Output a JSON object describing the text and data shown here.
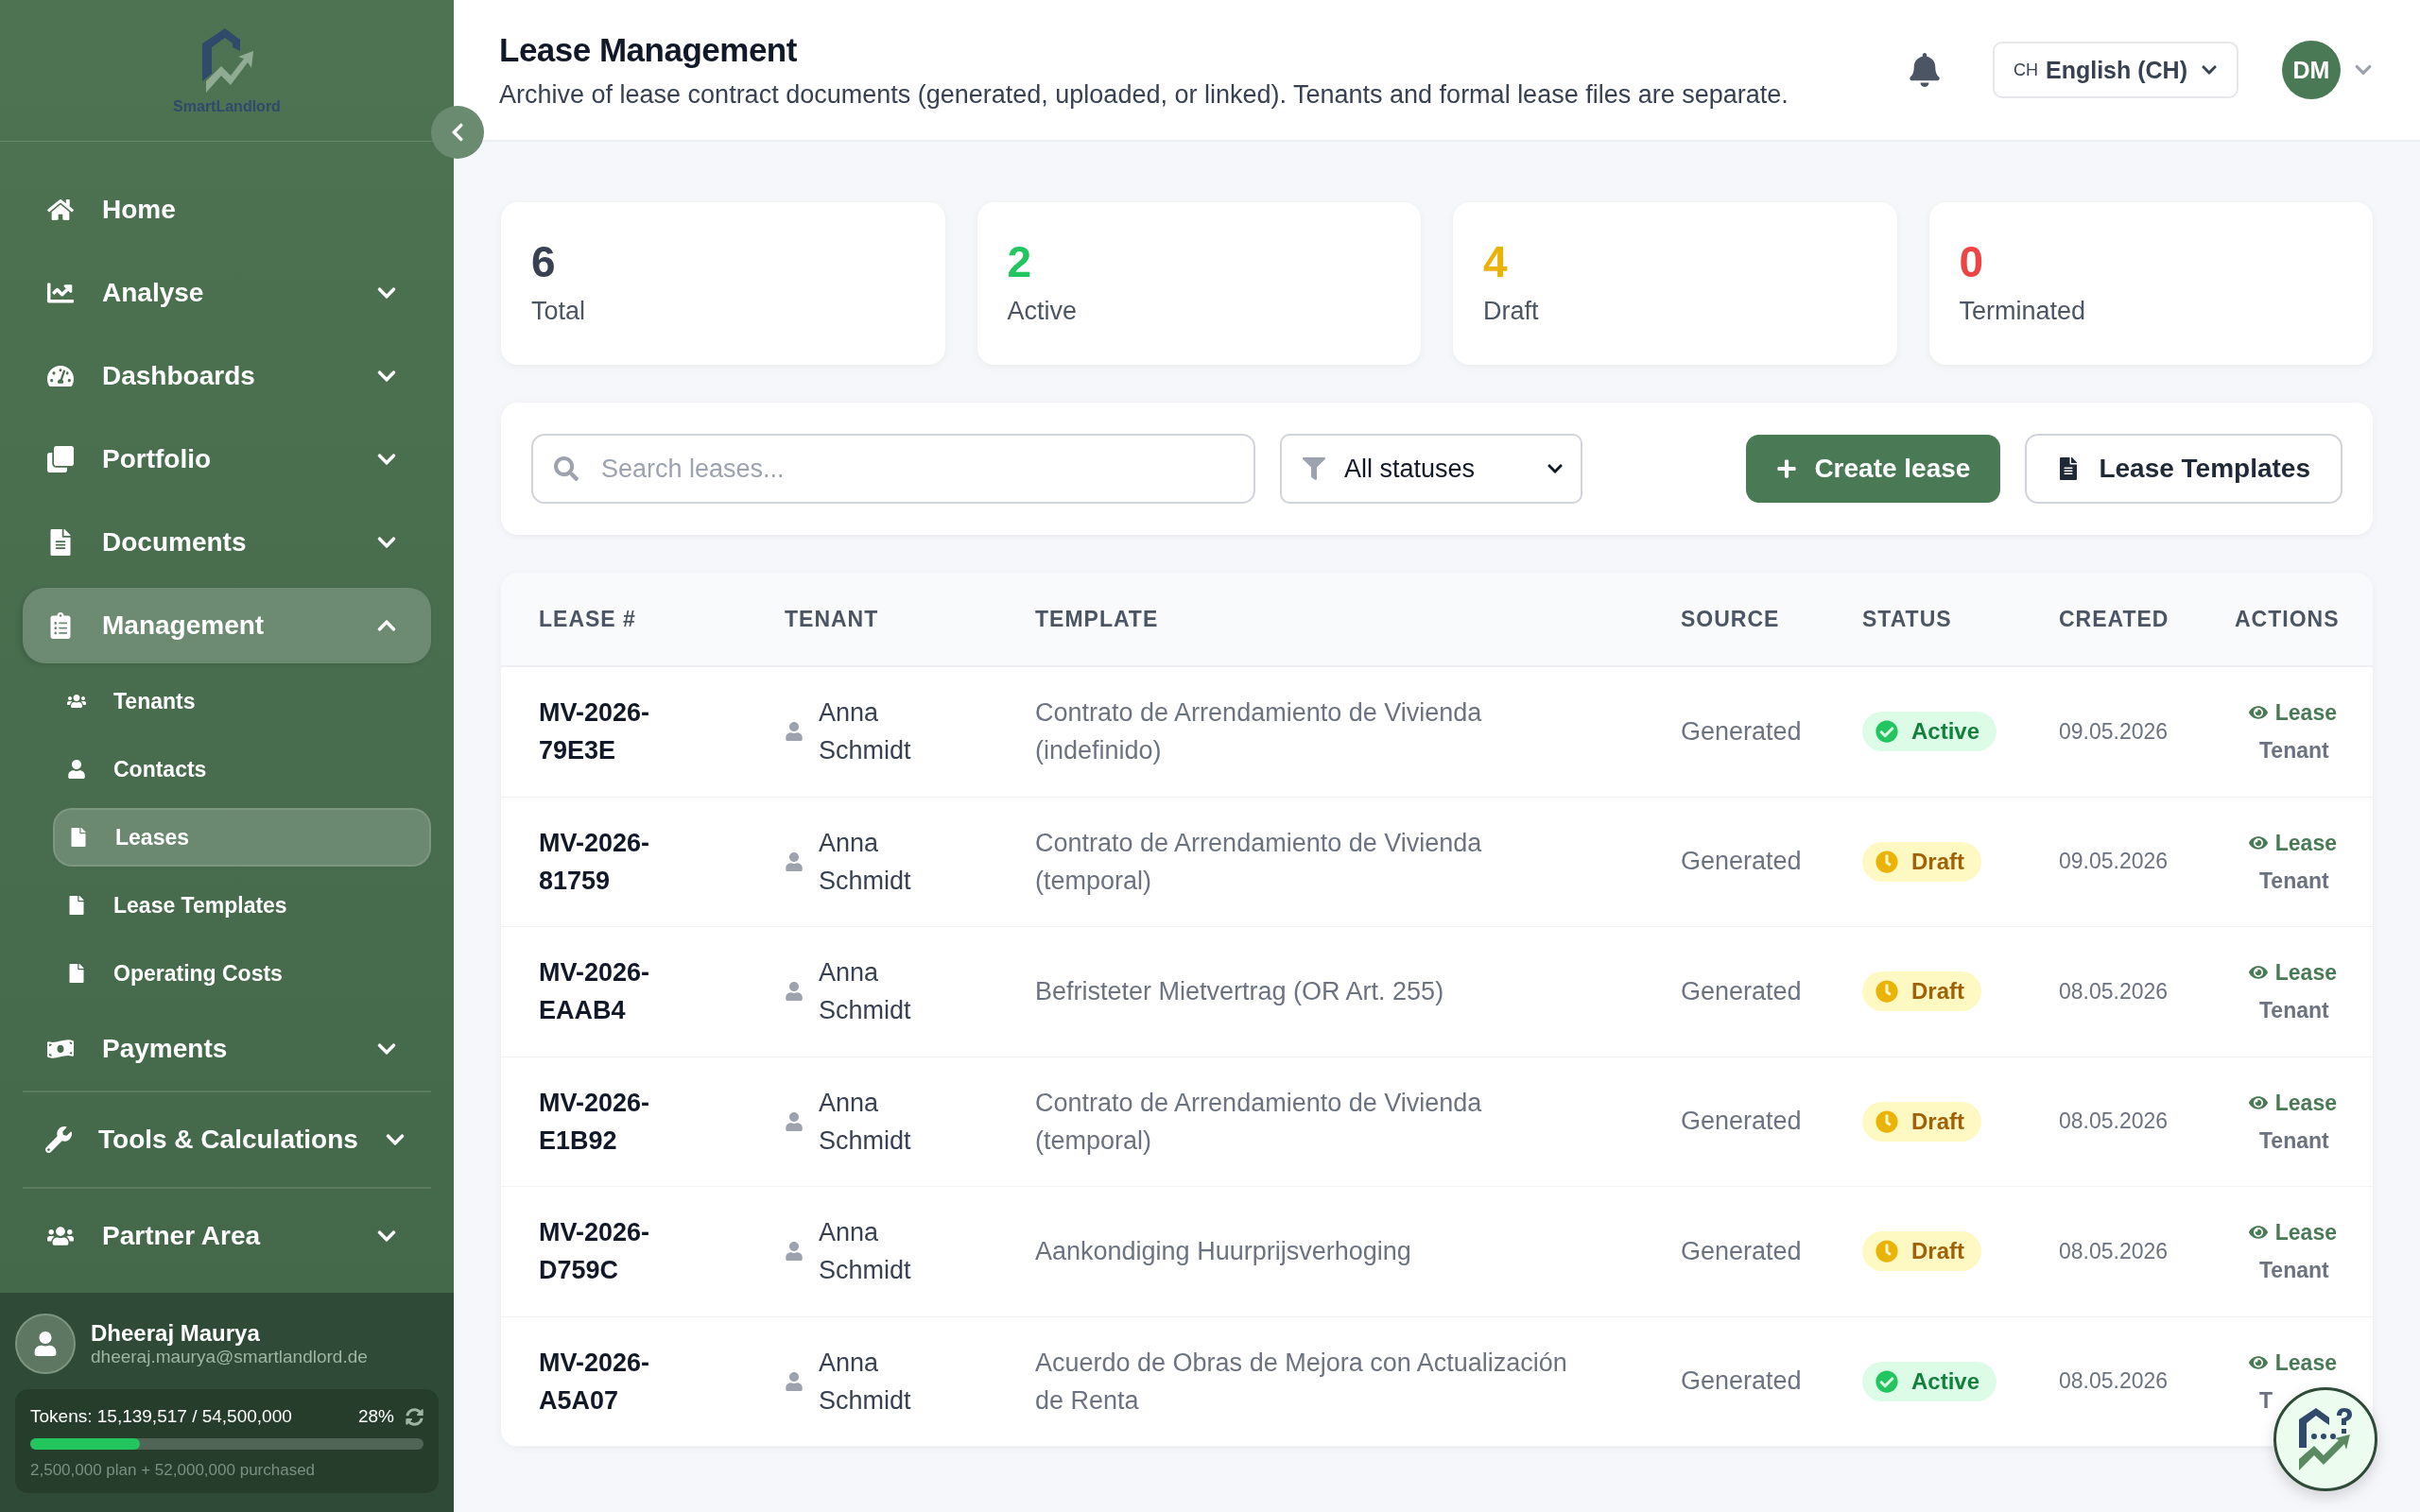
{
  "sidebar": {
    "logo_text": "SmartLandlord",
    "sections": [
      {
        "items": [
          {
            "label": "Home",
            "kind": "link",
            "selected": false
          },
          {
            "label": "Analyse",
            "kind": "group",
            "selected": false,
            "expanded": false
          },
          {
            "label": "Dashboards",
            "kind": "group",
            "selected": false,
            "expanded": false
          },
          {
            "label": "Portfolio",
            "kind": "group",
            "selected": false,
            "expanded": false
          },
          {
            "label": "Documents",
            "kind": "group",
            "selected": false,
            "expanded": false
          },
          {
            "label": "Management",
            "kind": "group",
            "selected": true,
            "expanded": true,
            "children": [
              {
                "label": "Tenants",
                "selected": false
              },
              {
                "label": "Contacts",
                "selected": false
              },
              {
                "label": "Leases",
                "selected": true
              },
              {
                "label": "Lease Templates",
                "selected": false
              },
              {
                "label": "Operating Costs",
                "selected": false
              }
            ]
          },
          {
            "label": "Payments",
            "kind": "group",
            "selected": false,
            "expanded": false
          }
        ]
      },
      {
        "items": [
          {
            "label": "Tools & Calculations",
            "kind": "group",
            "selected": false,
            "expanded": false
          }
        ]
      },
      {
        "items": [
          {
            "label": "Partner Area",
            "kind": "group",
            "selected": false,
            "expanded": false
          }
        ]
      }
    ],
    "user": {
      "name": "Dheeraj Maurya",
      "email": "dheeraj.maurya@smartlandlord.de"
    },
    "tokens": {
      "label": "Tokens: 15,139,517 / 54,500,000",
      "percent": "28%",
      "level": 0.28,
      "detail": "2,500,000 plan + 52,000,000 purchased"
    }
  },
  "header": {
    "title": "Lease Management",
    "subtitle": "Archive of lease contract documents (generated, uploaded, or linked). Tenants and formal lease files are separate.",
    "language": {
      "code": "CH",
      "label": "English (CH)"
    },
    "avatar": "DM"
  },
  "stats": [
    {
      "value": "6",
      "label": "Total",
      "color": "#374151"
    },
    {
      "value": "2",
      "label": "Active",
      "color": "#22c55e"
    },
    {
      "value": "4",
      "label": "Draft",
      "color": "#eab308"
    },
    {
      "value": "0",
      "label": "Terminated",
      "color": "#ef4444"
    }
  ],
  "toolbar": {
    "search": {
      "placeholder": "Search leases..."
    },
    "filter": "All statuses",
    "buttons": [
      "Create lease",
      "Lease Templates"
    ]
  },
  "table": {
    "columns": [
      "LEASE #",
      "TENANT",
      "TEMPLATE",
      "SOURCE",
      "STATUS",
      "CREATED",
      "ACTIONS"
    ],
    "rows": [
      {
        "lease": "MV-2026-79E3E",
        "tenant": "Anna Schmidt",
        "template": "Contrato de Arrendamiento de Vivienda (indefinido)",
        "source": "Generated",
        "status": {
          "label": "Active",
          "kind": "active"
        },
        "created": "09.05.2026",
        "actions": [
          "Lease",
          "Tenant"
        ]
      },
      {
        "lease": "MV-2026-81759",
        "tenant": "Anna Schmidt",
        "template": "Contrato de Arrendamiento de Vivienda (temporal)",
        "source": "Generated",
        "status": {
          "label": "Draft",
          "kind": "draft"
        },
        "created": "09.05.2026",
        "actions": [
          "Lease",
          "Tenant"
        ]
      },
      {
        "lease": "MV-2026-EAAB4",
        "tenant": "Anna Schmidt",
        "template": "Befristeter Mietvertrag (OR Art. 255)",
        "source": "Generated",
        "status": {
          "label": "Draft",
          "kind": "draft"
        },
        "created": "08.05.2026",
        "actions": [
          "Lease",
          "Tenant"
        ]
      },
      {
        "lease": "MV-2026-E1B92",
        "tenant": "Anna Schmidt",
        "template": "Contrato de Arrendamiento de Vivienda (temporal)",
        "source": "Generated",
        "status": {
          "label": "Draft",
          "kind": "draft"
        },
        "created": "08.05.2026",
        "actions": [
          "Lease",
          "Tenant"
        ]
      },
      {
        "lease": "MV-2026-D759C",
        "tenant": "Anna Schmidt",
        "template": "Aankondiging Huurprijsverhoging",
        "source": "Generated",
        "status": {
          "label": "Draft",
          "kind": "draft"
        },
        "created": "08.05.2026",
        "actions": [
          "Lease",
          "Tenant"
        ]
      },
      {
        "lease": "MV-2026-A5A07",
        "tenant": "Anna Schmidt",
        "template": "Acuerdo de Obras de Mejora con Actualización de Renta",
        "source": "Generated",
        "status": {
          "label": "Active",
          "kind": "active"
        },
        "created": "08.05.2026",
        "actions": [
          "Lease",
          "T"
        ]
      }
    ]
  }
}
